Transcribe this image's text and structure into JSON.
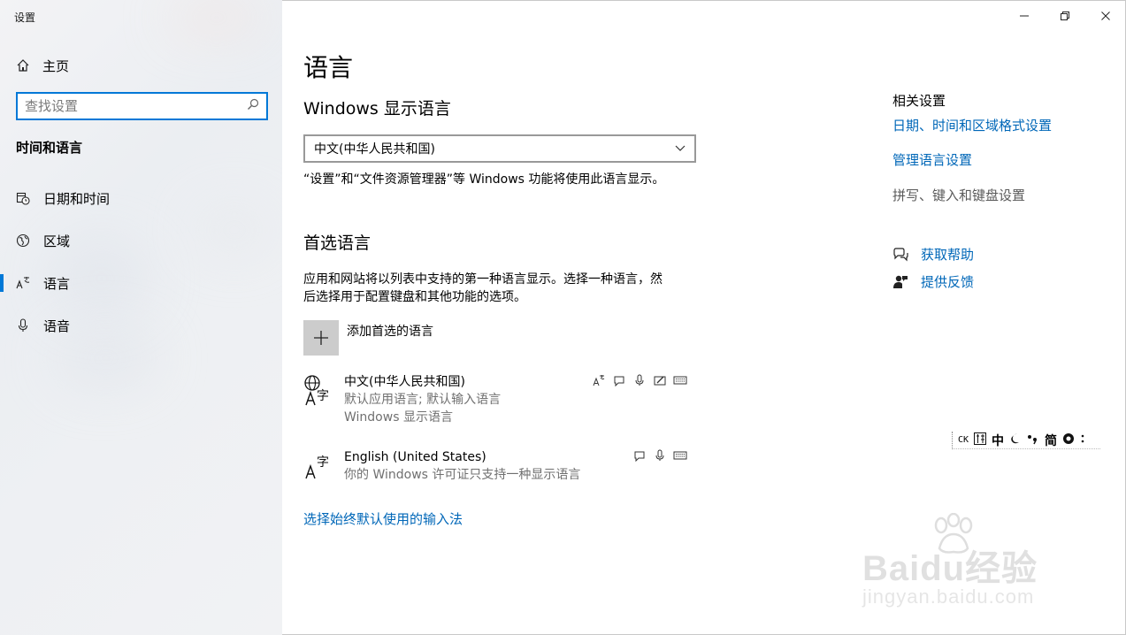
{
  "window": {
    "title": "设置"
  },
  "sidebar": {
    "home_label": "主页",
    "search_placeholder": "查找设置",
    "section_title": "时间和语言",
    "items": [
      {
        "label": "日期和时间",
        "icon": "calendar-clock-icon"
      },
      {
        "label": "区域",
        "icon": "globe-region-icon"
      },
      {
        "label": "语言",
        "icon": "language-icon",
        "selected": true
      },
      {
        "label": "语音",
        "icon": "microphone-icon"
      }
    ]
  },
  "main": {
    "title": "语言",
    "display_language": {
      "heading": "Windows 显示语言",
      "selected": "中文(中华人民共和国)",
      "description": "“设置”和“文件资源管理器”等 Windows 功能将使用此语言显示。"
    },
    "preferred": {
      "heading": "首选语言",
      "description_line1": "应用和网站将以列表中支持的第一种语言显示。选择一种语言，然",
      "description_line2": "后选择用于配置键盘和其他功能的选项。",
      "add_label": "添加首选的语言",
      "languages": [
        {
          "name": "中文(中华人民共和国)",
          "sub1": "默认应用语言; 默认输入语言",
          "sub2": "Windows 显示语言"
        },
        {
          "name": "English (United States)",
          "sub1": "你的 Windows 许可证只支持一种显示语言"
        }
      ]
    },
    "bottom_link": "选择始终默认使用的输入法"
  },
  "related": {
    "title": "相关设置",
    "links": [
      "日期、时间和区域格式设置",
      "管理语言设置"
    ],
    "disabled_text": "拼写、键入和键盘设置",
    "help": "获取帮助",
    "feedback": "提供反馈"
  },
  "ime": {
    "ck": "CK",
    "items": [
      "中",
      "简"
    ]
  },
  "watermark": {
    "text": "Baidu经验",
    "url": "jingyan.baidu.com"
  },
  "colors": {
    "accent": "#0078d7",
    "link": "#0067b8"
  }
}
